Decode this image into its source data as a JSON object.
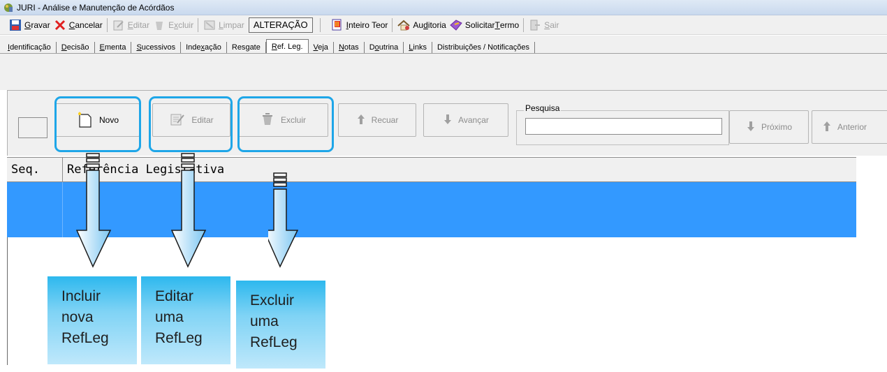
{
  "window": {
    "title": "JURI - Análise e Manutenção de Acórdãos"
  },
  "toolbar": {
    "gravar": {
      "label_u": "G",
      "label_rest": "ravar",
      "icon": "floppy-save-icon"
    },
    "cancelar": {
      "label_u": "C",
      "label_rest": "ancelar",
      "icon": "red-x-icon"
    },
    "editar": {
      "label_u": "E",
      "label_rest": "ditar",
      "icon": "edit-icon"
    },
    "excluir": {
      "label_pre": "E",
      "label_u": "x",
      "label_rest": "cluir",
      "icon": "delete-icon"
    },
    "limpar": {
      "label_u": "L",
      "label_rest": "impar",
      "icon": "clear-icon"
    },
    "mode": "ALTERAÇÃO",
    "inteiro_teor": {
      "label_u": "I",
      "label_rest": "nteiro Teor",
      "icon": "document-icon"
    },
    "auditoria": {
      "label_pre": "Au",
      "label_u": "d",
      "label_rest": "itoria",
      "icon": "audit-icon"
    },
    "solicitar_termo": {
      "label_pre": "Solicitar ",
      "label_u": "T",
      "label_rest": "ermo",
      "icon": "book-icon"
    },
    "sair": {
      "label_u": "S",
      "label_rest": "air",
      "icon": "exit-icon"
    }
  },
  "tabs": [
    {
      "pre": "",
      "u": "I",
      "rest": "dentificação",
      "active": false
    },
    {
      "pre": "",
      "u": "D",
      "rest": "ecisão",
      "active": false
    },
    {
      "pre": "",
      "u": "E",
      "rest": "menta",
      "active": false
    },
    {
      "pre": "",
      "u": "S",
      "rest": "ucessivos",
      "active": false
    },
    {
      "pre": "Inde",
      "u": "x",
      "rest": "ação",
      "active": false
    },
    {
      "pre": "Res",
      "u": "g",
      "rest": "ate",
      "active": false
    },
    {
      "pre": "",
      "u": "R",
      "rest": "ef. Leg.",
      "active": true
    },
    {
      "pre": "",
      "u": "V",
      "rest": "eja",
      "active": false
    },
    {
      "pre": "",
      "u": "N",
      "rest": "otas",
      "active": false
    },
    {
      "pre": "D",
      "u": "o",
      "rest": "utrina",
      "active": false
    },
    {
      "pre": "",
      "u": "L",
      "rest": "inks",
      "active": false
    },
    {
      "pre": "Distribuições / Notificações",
      "u": "",
      "rest": "",
      "active": false
    }
  ],
  "commands": {
    "novo": "Novo",
    "editar": "Editar",
    "excluir": "Excluir",
    "recuar": "Recuar",
    "avancar": "Avançar",
    "proximo": "Próximo",
    "anterior": "Anterior"
  },
  "search": {
    "legend": "Pesquisa",
    "value": ""
  },
  "grid": {
    "columns": [
      "Seq.",
      "Referência Legislativa"
    ],
    "rows": [
      {
        "seq": "",
        "ref": ""
      }
    ]
  },
  "callouts": [
    {
      "lines": [
        "Incluir",
        "nova",
        "RefLeg"
      ]
    },
    {
      "lines": [
        "Editar",
        "uma",
        "RefLeg"
      ]
    },
    {
      "lines": [
        "Excluir",
        "uma",
        "RefLeg"
      ]
    }
  ],
  "colors": {
    "selection": "#3399ff",
    "highlight": "#1ea6e8",
    "callout": "#2db8ee"
  }
}
